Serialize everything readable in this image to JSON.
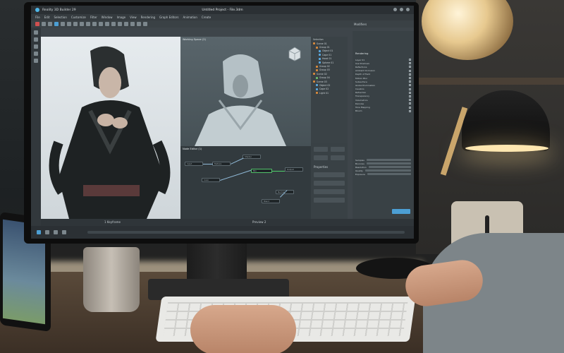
{
  "window": {
    "app_name": "Reality 3D Builder 29",
    "document_title": "Untitled Project - File.3dm"
  },
  "menu": [
    "File",
    "Edit",
    "Selection",
    "Customize",
    "Filter",
    "Window",
    "Image",
    "View",
    "Rendering",
    "Graph Editors",
    "Animation",
    "Create"
  ],
  "panels": {
    "modifiers_label": "Modifiers",
    "viewport_mid_title": "Working Space (2)",
    "selection_title": "Selection",
    "node_graph_title": "Node Editor (1)",
    "properties_title": "Properties",
    "rendering_title": "Rendering",
    "bottom_left_label": "1 Keyframe",
    "bottom_mid_label": "Preview 2"
  },
  "outliner_items": [
    {
      "label": "Scene 01",
      "level": 0
    },
    {
      "label": "Group 01",
      "level": 1
    },
    {
      "label": "Object 01",
      "level": 2
    },
    {
      "label": "Cape 01",
      "level": 2
    },
    {
      "label": "Hood 01",
      "level": 2
    },
    {
      "label": "Sphere 01",
      "level": 2
    },
    {
      "label": "Group 02",
      "level": 1
    },
    {
      "label": "Group 03",
      "level": 1
    },
    {
      "label": "Scene 02",
      "level": 0
    },
    {
      "label": "Group 04",
      "level": 1
    },
    {
      "label": "Scene 03",
      "level": 0
    },
    {
      "label": "Object 02",
      "level": 1
    },
    {
      "label": "Cape 02",
      "level": 1
    },
    {
      "label": "Light 01",
      "level": 1
    }
  ],
  "rendering_options": [
    "Layer 01",
    "Use Shadows",
    "Reflections",
    "Ambient Occlusion",
    "Depth of Field",
    "Motion Blur",
    "Subsurface",
    "Global Illumination",
    "Caustics",
    "Refraction",
    "Transparency",
    "Volumetrics",
    "Denoise",
    "Tone Mapping",
    "Bloom"
  ],
  "field_labels": [
    "Samples",
    "Bounces",
    "Resolution",
    "Quality",
    "Exposure"
  ],
  "node_labels": [
    "Input",
    "Texture",
    "Shader",
    "Mix",
    "Output",
    "Color",
    "Normal",
    "Blend"
  ],
  "colors": {
    "accent_blue": "#4fb7e8",
    "accent_red": "#d05050",
    "select_green": "#52c26b",
    "ui_dark": "#2b3034",
    "ui_panel": "#394145"
  }
}
